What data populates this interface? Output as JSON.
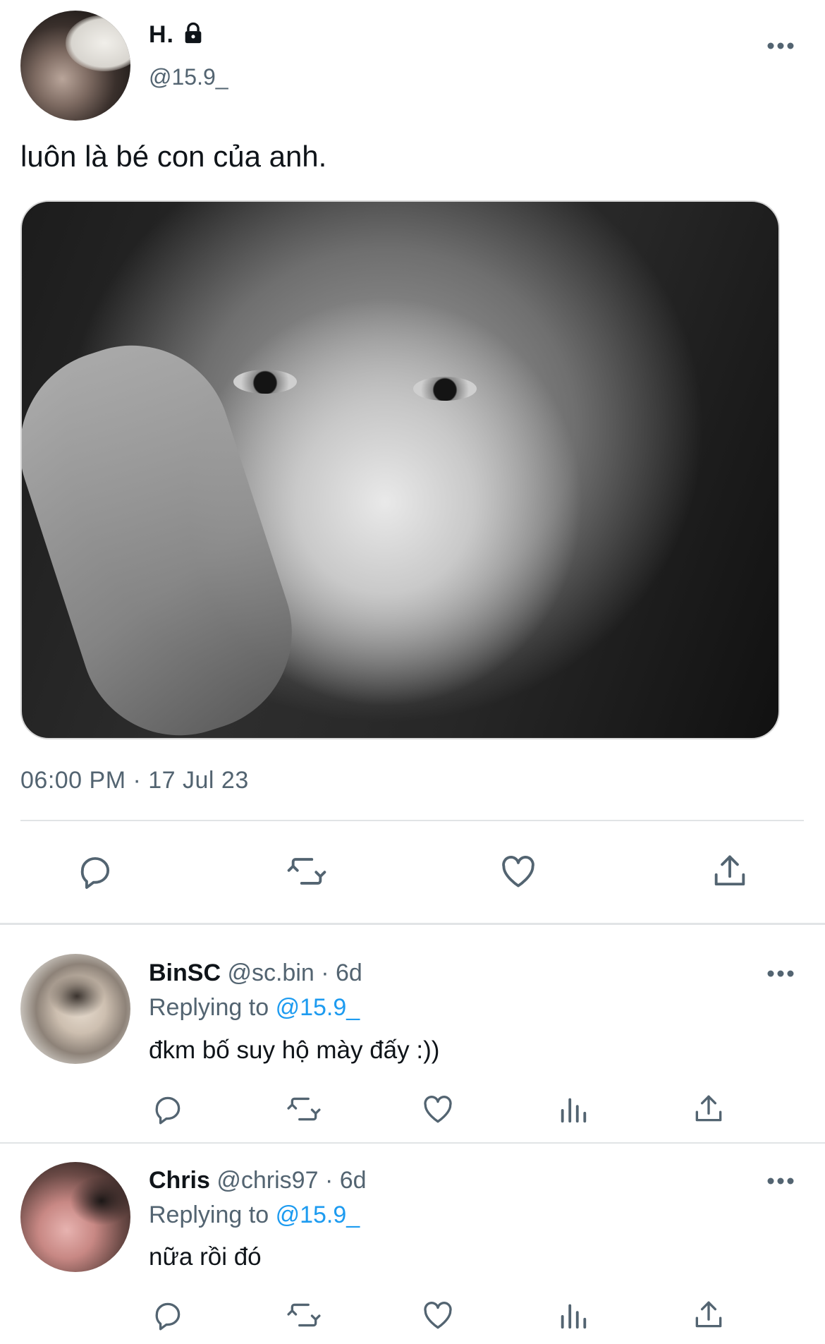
{
  "tweet": {
    "display_name": "H.",
    "handle": "@15.9_",
    "text": "luôn là bé con của anh.",
    "timestamp": "06:00 PM · 17 Jul 23",
    "more_icon": "more-horizontal-icon",
    "lock_icon": "lock-icon",
    "actions": [
      "reply-icon",
      "retweet-icon",
      "like-icon",
      "share-icon"
    ]
  },
  "replies": [
    {
      "name": "BinSC",
      "meta": "@sc.bin · 6d",
      "replying_label": "Replying to",
      "replying_to": "@15.9_",
      "text": "đkm bố suy hộ mày đấy :))"
    },
    {
      "name": "Chris",
      "meta": "@chris97 · 6d",
      "replying_label": "Replying to",
      "replying_to": "@15.9_",
      "text": "nữa rồi đó"
    }
  ],
  "reply_actions": [
    "reply-icon",
    "retweet-icon",
    "like-icon",
    "analytics-icon",
    "share-icon"
  ],
  "colors": {
    "accent": "#1d9bf0",
    "secondary_text": "#536471",
    "primary_text": "#0f1419",
    "divider": "#e1e4e6"
  }
}
